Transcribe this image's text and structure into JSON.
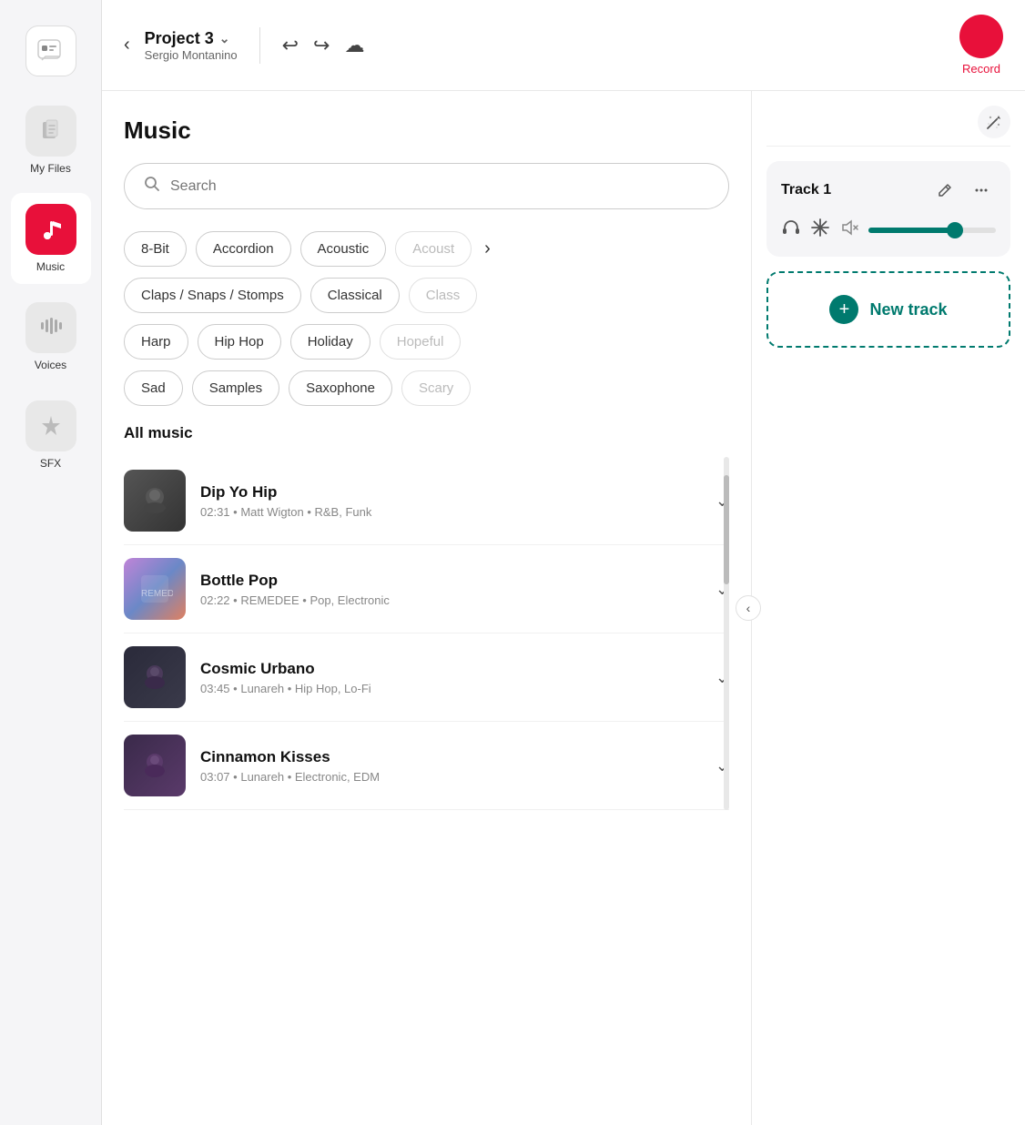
{
  "app": {
    "logo_icon": "💬",
    "project_name": "Project 3",
    "project_owner": "Sergio Montanino",
    "record_label": "Record"
  },
  "sidebar": {
    "items": [
      {
        "id": "logo",
        "icon": "🗨",
        "label": ""
      },
      {
        "id": "myfiles",
        "icon": "📄",
        "label": "My Files"
      },
      {
        "id": "music",
        "icon": "🎵",
        "label": "Music"
      },
      {
        "id": "voices",
        "icon": "🎚",
        "label": "Voices"
      },
      {
        "id": "sfx",
        "icon": "✨",
        "label": "SFX"
      }
    ]
  },
  "music_panel": {
    "title": "Music",
    "search_placeholder": "Search",
    "tags_row1": [
      {
        "id": "8bit",
        "label": "8-Bit",
        "faded": false
      },
      {
        "id": "accordion",
        "label": "Accordion",
        "faded": false
      },
      {
        "id": "acoustic",
        "label": "Acoustic",
        "faded": false
      },
      {
        "id": "acoustic2",
        "label": "Acoust",
        "faded": true
      }
    ],
    "tags_row2": [
      {
        "id": "claps",
        "label": "Claps / Snaps / Stomps",
        "faded": false
      },
      {
        "id": "classical",
        "label": "Classical",
        "faded": false
      },
      {
        "id": "class2",
        "label": "Class",
        "faded": true
      }
    ],
    "tags_row3": [
      {
        "id": "harp",
        "label": "Harp",
        "faded": false
      },
      {
        "id": "hiphop",
        "label": "Hip Hop",
        "faded": false
      },
      {
        "id": "holiday",
        "label": "Holiday",
        "faded": false
      },
      {
        "id": "hopeful",
        "label": "Hopeful",
        "faded": true
      }
    ],
    "tags_row4": [
      {
        "id": "sad",
        "label": "Sad",
        "faded": false
      },
      {
        "id": "samples",
        "label": "Samples",
        "faded": false
      },
      {
        "id": "saxophone",
        "label": "Saxophone",
        "faded": false
      },
      {
        "id": "scary",
        "label": "Scary",
        "faded": true
      }
    ],
    "section_title": "All music",
    "tracks": [
      {
        "id": "dip-yo-hip",
        "name": "Dip Yo Hip",
        "duration": "02:31",
        "artist": "Matt Wigton",
        "genre": "R&B, Funk",
        "thumb_class": "hip"
      },
      {
        "id": "bottle-pop",
        "name": "Bottle Pop",
        "duration": "02:22",
        "artist": "REMEDEE",
        "genre": "Pop, Electronic",
        "thumb_class": "bottle"
      },
      {
        "id": "cosmic-urbano",
        "name": "Cosmic Urbano",
        "duration": "03:45",
        "artist": "Lunareh",
        "genre": "Hip Hop, Lo-Fi",
        "thumb_class": "cosmic"
      },
      {
        "id": "cinnamon-kisses",
        "name": "Cinnamon Kisses",
        "duration": "03:07",
        "artist": "Lunareh",
        "genre": "Electronic, EDM",
        "thumb_class": "cinnamon"
      }
    ]
  },
  "right_panel": {
    "track1_name": "Track 1",
    "new_track_label": "New track",
    "volume_percent": 70
  }
}
